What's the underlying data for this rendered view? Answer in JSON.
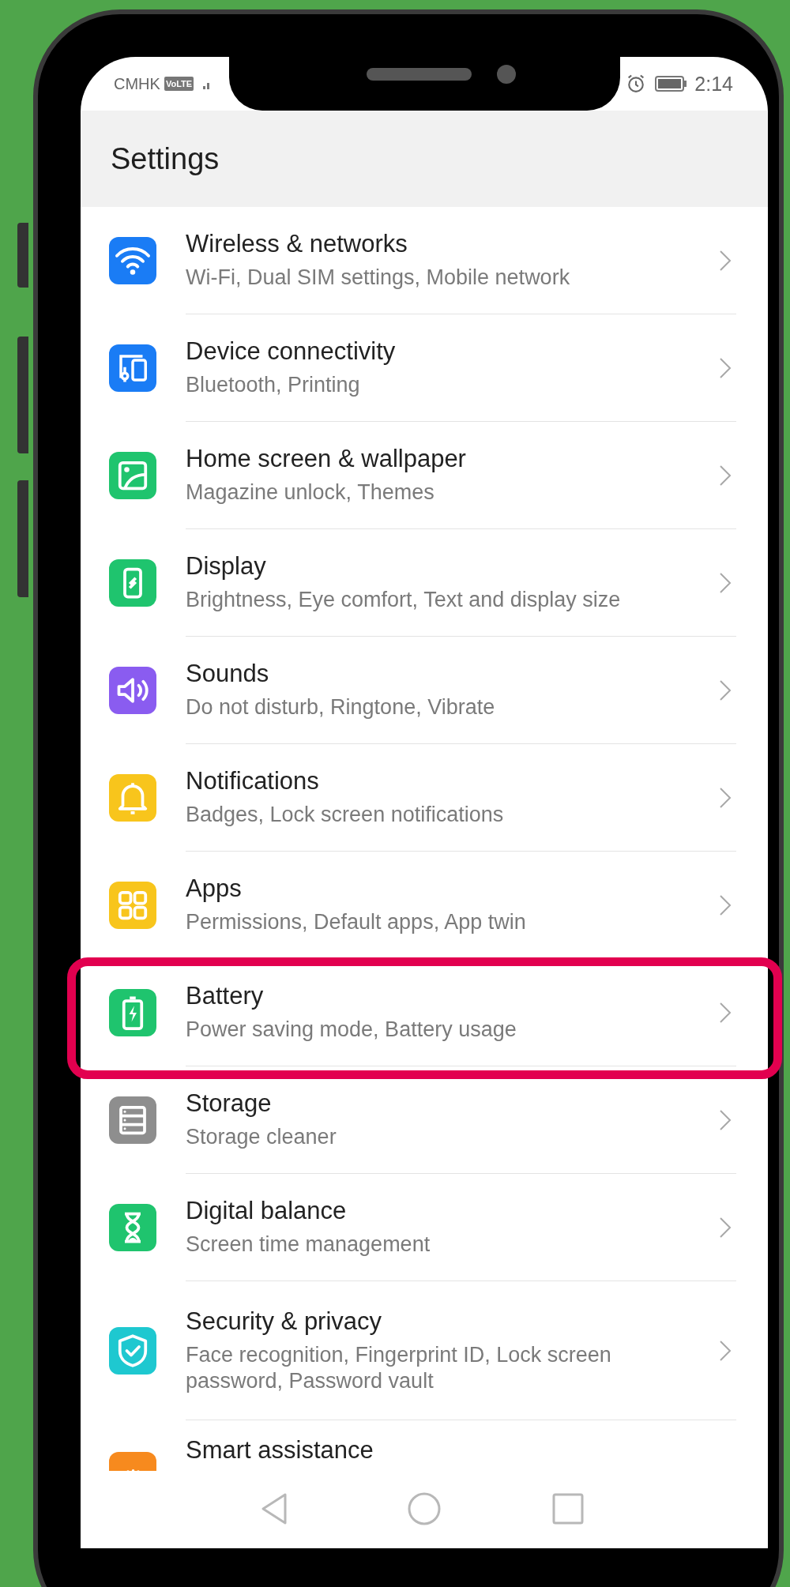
{
  "status_bar": {
    "carrier": "CMHK",
    "network_badge": "VoLTE",
    "time": "2:14"
  },
  "header": {
    "title": "Settings"
  },
  "items": [
    {
      "title": "Wireless & networks",
      "subtitle": "Wi-Fi, Dual SIM settings, Mobile network",
      "color": "#1a7cf5",
      "highlighted": false
    },
    {
      "title": "Device connectivity",
      "subtitle": "Bluetooth, Printing",
      "color": "#1a7cf5",
      "highlighted": false
    },
    {
      "title": "Home screen & wallpaper",
      "subtitle": "Magazine unlock, Themes",
      "color": "#1fc46e",
      "highlighted": false
    },
    {
      "title": "Display",
      "subtitle": "Brightness, Eye comfort, Text and display size",
      "color": "#1fc46e",
      "highlighted": false
    },
    {
      "title": "Sounds",
      "subtitle": "Do not disturb, Ringtone, Vibrate",
      "color": "#8a5cf0",
      "highlighted": false
    },
    {
      "title": "Notifications",
      "subtitle": "Badges, Lock screen notifications",
      "color": "#f8c51c",
      "highlighted": false
    },
    {
      "title": "Apps",
      "subtitle": "Permissions, Default apps, App twin",
      "color": "#f8c51c",
      "highlighted": false
    },
    {
      "title": "Battery",
      "subtitle": "Power saving mode, Battery usage",
      "color": "#1fc46e",
      "highlighted": true
    },
    {
      "title": "Storage",
      "subtitle": "Storage cleaner",
      "color": "#8e8e8e",
      "highlighted": false
    },
    {
      "title": "Digital balance",
      "subtitle": "Screen time management",
      "color": "#1fc46e",
      "highlighted": false
    },
    {
      "title": "Security & privacy",
      "subtitle": "Face recognition, Fingerprint ID, Lock screen password, Password vault",
      "color": "#1ec8d0",
      "highlighted": false
    },
    {
      "title": "Smart assistance",
      "color": "#f78a1e",
      "highlighted": false
    }
  ]
}
